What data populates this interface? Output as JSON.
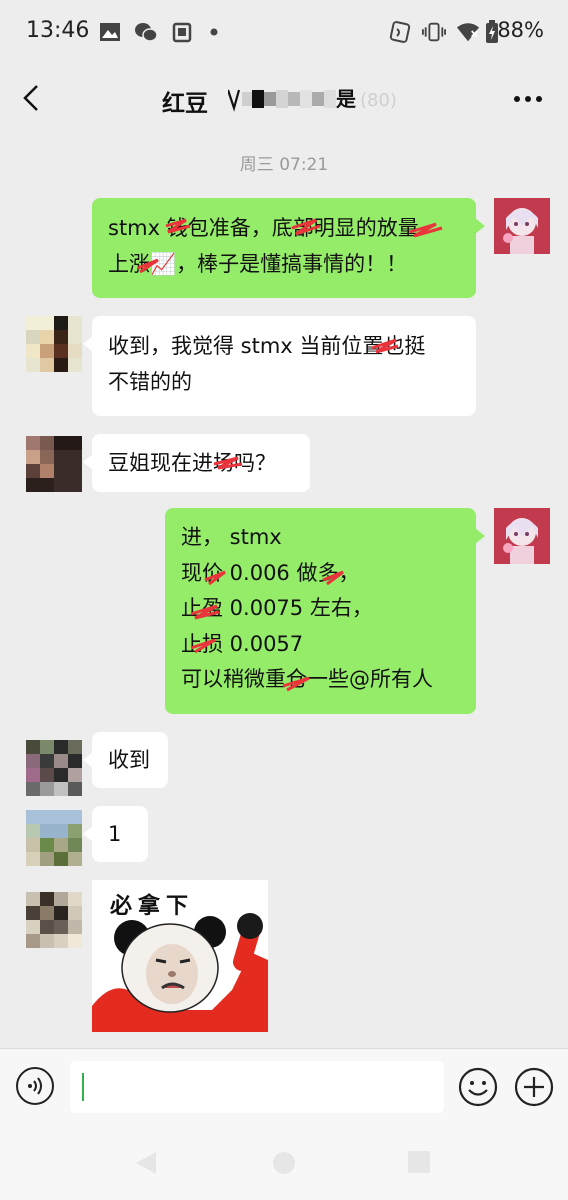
{
  "status_bar": {
    "time": "13:46",
    "battery": "88%",
    "icons": [
      "photo-icon",
      "wechat-icon",
      "notification-icon",
      "dot-icon",
      "nfc-icon",
      "vibrate-icon",
      "wifi-icon",
      "battery-icon"
    ]
  },
  "header": {
    "title_visible": "红豆",
    "back_icon": "chevron-left-icon",
    "more_icon": "more-icon"
  },
  "chat": {
    "timestamp": "周三 07:21",
    "messages": [
      {
        "side": "right",
        "lines": [
          "stmx 钱包准备，底部明显的放量",
          "上涨📈，棒子是懂搞事情的！！"
        ]
      },
      {
        "side": "left",
        "lines": [
          "收到，我觉得 stmx 当前位置也挺",
          "不错的的"
        ]
      },
      {
        "side": "left",
        "lines": [
          "豆姐现在进场吗？"
        ]
      },
      {
        "side": "right",
        "lines": [
          "进， stmx",
          "现价 0.006 做多，",
          "止盈 0.0075 左右，",
          "止损 0.0057",
          "可以稍微重仓一些@所有人"
        ]
      },
      {
        "side": "left",
        "lines": [
          "收到"
        ]
      },
      {
        "side": "left",
        "lines": [
          "1"
        ]
      }
    ],
    "sticker": {
      "caption": "必拿下"
    }
  },
  "input_bar": {
    "value": "",
    "voice_icon": "voice-icon",
    "emoji_icon": "emoji-icon",
    "plus_icon": "plus-icon"
  },
  "nav_bar": {
    "icons": [
      "back-triangle-icon",
      "home-circle-icon",
      "recents-square-icon"
    ]
  },
  "colors": {
    "bg": "#ededed",
    "my_bubble": "#95ec69",
    "their_bubble": "#ffffff",
    "cursor": "#2fb34a",
    "scribble": "#e8343a"
  }
}
